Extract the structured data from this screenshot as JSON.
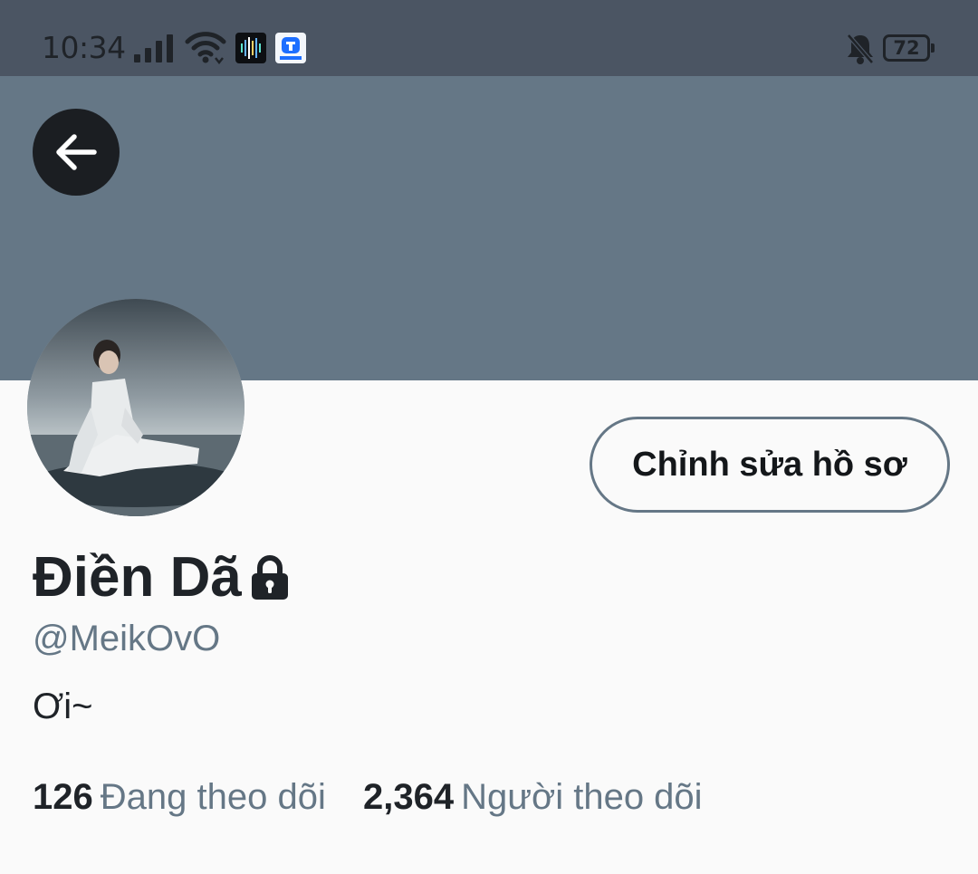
{
  "status_bar": {
    "time": "10:34",
    "battery_level": "72",
    "icons": [
      "signal-icon",
      "wifi-icon",
      "app-icon-audio",
      "app-icon-tencent",
      "bell-off-icon",
      "battery-icon"
    ]
  },
  "header": {
    "back_icon": "arrow-left-icon",
    "banner_color": "#657786"
  },
  "profile": {
    "display_name": "Điền Dã",
    "protected_icon": "lock-icon",
    "username": "@MeikOvO",
    "bio": "Ơi~",
    "edit_button_label": "Chỉnh sửa hồ sơ",
    "following_count": "126",
    "following_label": "Đang theo dõi",
    "followers_count": "2,364",
    "followers_label": "Người theo dõi"
  },
  "colors": {
    "status_bar": "#4b5563",
    "banner": "#657786",
    "secondary_text": "#657786",
    "primary_text": "#1f2328",
    "background": "#fafafa"
  }
}
